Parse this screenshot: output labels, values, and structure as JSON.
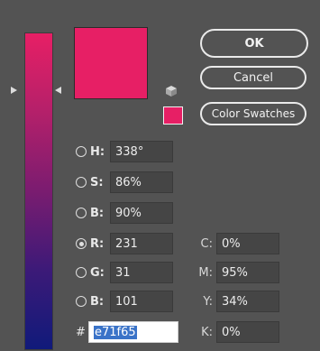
{
  "colors": {
    "current": "#e71f65",
    "hue_gradient": [
      "#e71f65",
      "#b4206a",
      "#7a1c70",
      "#3c1a78",
      "#101a7a"
    ]
  },
  "buttons": {
    "ok": "OK",
    "cancel": "Cancel",
    "color_swatches": "Color Swatches"
  },
  "icons": {
    "gamut": "cube-icon"
  },
  "hsb": {
    "h_label": "H:",
    "h_value": "338°",
    "s_label": "S:",
    "s_value": "86%",
    "b_label": "B:",
    "b_value": "90%"
  },
  "rgb": {
    "r_label": "R:",
    "r_value": "231",
    "g_label": "G:",
    "g_value": "31",
    "b_label": "B:",
    "b_value": "101"
  },
  "cmyk": {
    "c_label": "C:",
    "c_value": "0%",
    "m_label": "M:",
    "m_value": "95%",
    "y_label": "Y:",
    "y_value": "34%",
    "k_label": "K:",
    "k_value": "0%"
  },
  "hex": {
    "label": "#",
    "value": "e71f65"
  }
}
